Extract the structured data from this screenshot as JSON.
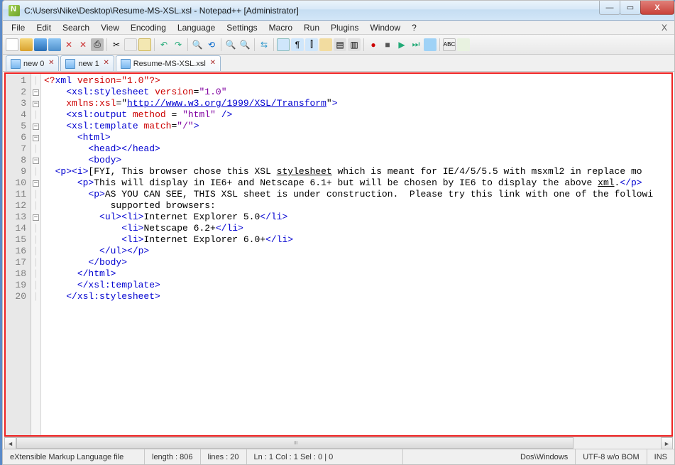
{
  "titlebar": {
    "title": "C:\\Users\\Nike\\Desktop\\Resume-MS-XSL.xsl - Notepad++ [Administrator]"
  },
  "menu": {
    "items": [
      "File",
      "Edit",
      "Search",
      "View",
      "Encoding",
      "Language",
      "Settings",
      "Macro",
      "Run",
      "Plugins",
      "Window",
      "?"
    ]
  },
  "tabs": {
    "items": [
      {
        "label": "new  0",
        "active": false,
        "close": "✕"
      },
      {
        "label": "new  1",
        "active": false,
        "close": "✕"
      },
      {
        "label": "Resume-MS-XSL.xsl",
        "active": true,
        "close": "✕"
      }
    ]
  },
  "code": {
    "lines": [
      {
        "n": 1,
        "fold": "",
        "segs": [
          {
            "c": "t-red",
            "t": "<?"
          },
          {
            "c": "t-blue",
            "t": "xml "
          },
          {
            "c": "t-red",
            "t": "version=\"1.0\""
          },
          {
            "c": "t-red",
            "t": "?>"
          }
        ],
        "indent": 0
      },
      {
        "n": 2,
        "fold": "box",
        "segs": [
          {
            "c": "t-blue",
            "t": "<xsl:stylesheet"
          },
          {
            "c": "",
            "t": " "
          },
          {
            "c": "t-red",
            "t": "version"
          },
          {
            "c": "",
            "t": "="
          },
          {
            "c": "t-purp",
            "t": "\"1.0\""
          }
        ],
        "indent": 2
      },
      {
        "n": 3,
        "fold": "box",
        "segs": [
          {
            "c": "t-red",
            "t": "xmlns:xsl"
          },
          {
            "c": "",
            "t": "=\""
          },
          {
            "c": "t-blue u",
            "t": "http://www.w3.org/1999/XSL/Transform"
          },
          {
            "c": "",
            "t": "\""
          },
          {
            "c": "t-blue",
            "t": ">"
          }
        ],
        "indent": 2
      },
      {
        "n": 4,
        "fold": "",
        "segs": [
          {
            "c": "t-blue",
            "t": "<xsl:output"
          },
          {
            "c": "",
            "t": " "
          },
          {
            "c": "t-red",
            "t": "method"
          },
          {
            "c": "",
            "t": " = "
          },
          {
            "c": "t-purp",
            "t": "\"html\""
          },
          {
            "c": "",
            "t": " "
          },
          {
            "c": "t-blue",
            "t": "/>"
          }
        ],
        "indent": 2
      },
      {
        "n": 5,
        "fold": "box",
        "segs": [
          {
            "c": "t-blue",
            "t": "<xsl:template"
          },
          {
            "c": "",
            "t": " "
          },
          {
            "c": "t-red",
            "t": "match"
          },
          {
            "c": "",
            "t": "="
          },
          {
            "c": "t-purp",
            "t": "\"/\""
          },
          {
            "c": "t-blue",
            "t": ">"
          }
        ],
        "indent": 2
      },
      {
        "n": 6,
        "fold": "box",
        "segs": [
          {
            "c": "t-blue",
            "t": "<html>"
          }
        ],
        "indent": 3
      },
      {
        "n": 7,
        "fold": "",
        "segs": [
          {
            "c": "t-blue",
            "t": "<head></head>"
          }
        ],
        "indent": 4
      },
      {
        "n": 8,
        "fold": "box",
        "segs": [
          {
            "c": "t-blue",
            "t": "<body>"
          }
        ],
        "indent": 4
      },
      {
        "n": 9,
        "fold": "",
        "segs": [
          {
            "c": "t-blue",
            "t": "<p><i>"
          },
          {
            "c": "",
            "t": "[FYI, This browser chose this XSL "
          },
          {
            "c": "u",
            "t": "stylesheet"
          },
          {
            "c": "",
            "t": " which is meant for IE/4/5/5.5 with msxml2 in replace mo"
          }
        ],
        "indent": 1
      },
      {
        "n": 10,
        "fold": "box",
        "segs": [
          {
            "c": "t-blue",
            "t": "<p>"
          },
          {
            "c": "",
            "t": "This will display in IE6+ and Netscape 6.1+ but will be chosen by IE6 to display the above "
          },
          {
            "c": "u",
            "t": "xml"
          },
          {
            "c": "",
            "t": "."
          },
          {
            "c": "t-blue",
            "t": "</p>"
          }
        ],
        "indent": 3
      },
      {
        "n": 11,
        "fold": "",
        "segs": [
          {
            "c": "t-blue",
            "t": "<p>"
          },
          {
            "c": "",
            "t": "AS YOU CAN SEE, THIS XSL sheet is under construction.  Please try this link with one of the followi"
          }
        ],
        "indent": 4
      },
      {
        "n": 12,
        "fold": "",
        "segs": [
          {
            "c": "",
            "t": "supported browsers:"
          }
        ],
        "indent": 6
      },
      {
        "n": 13,
        "fold": "box",
        "segs": [
          {
            "c": "t-blue",
            "t": "<ul><li>"
          },
          {
            "c": "",
            "t": "Internet Explorer 5.0"
          },
          {
            "c": "t-blue",
            "t": "</li>"
          }
        ],
        "indent": 5
      },
      {
        "n": 14,
        "fold": "",
        "segs": [
          {
            "c": "t-blue",
            "t": "<li>"
          },
          {
            "c": "",
            "t": "Netscape 6.2+"
          },
          {
            "c": "t-blue",
            "t": "</li>"
          }
        ],
        "indent": 7
      },
      {
        "n": 15,
        "fold": "",
        "segs": [
          {
            "c": "t-blue",
            "t": "<li>"
          },
          {
            "c": "",
            "t": "Internet Explorer 6.0+"
          },
          {
            "c": "t-blue",
            "t": "</li>"
          }
        ],
        "indent": 7
      },
      {
        "n": 16,
        "fold": "",
        "segs": [
          {
            "c": "t-blue",
            "t": "</ul></p>"
          }
        ],
        "indent": 5
      },
      {
        "n": 17,
        "fold": "",
        "segs": [
          {
            "c": "t-blue",
            "t": "</body>"
          }
        ],
        "indent": 4
      },
      {
        "n": 18,
        "fold": "",
        "segs": [
          {
            "c": "t-blue",
            "t": "</html>"
          }
        ],
        "indent": 3
      },
      {
        "n": 19,
        "fold": "",
        "segs": [
          {
            "c": "t-blue",
            "t": "</xsl:template>"
          }
        ],
        "indent": 3
      },
      {
        "n": 20,
        "fold": "",
        "segs": [
          {
            "c": "t-blue",
            "t": "</xsl:stylesheet>"
          }
        ],
        "indent": 2
      }
    ]
  },
  "status": {
    "filetype": "eXtensible Markup Language file",
    "length": "length : 806",
    "lines": "lines : 20",
    "pos": "Ln : 1    Col : 1    Sel : 0 | 0",
    "eol": "Dos\\Windows",
    "enc": "UTF-8 w/o BOM",
    "ovr": "INS"
  },
  "winbtns": {
    "min": "—",
    "max": "▭",
    "close": "X"
  }
}
